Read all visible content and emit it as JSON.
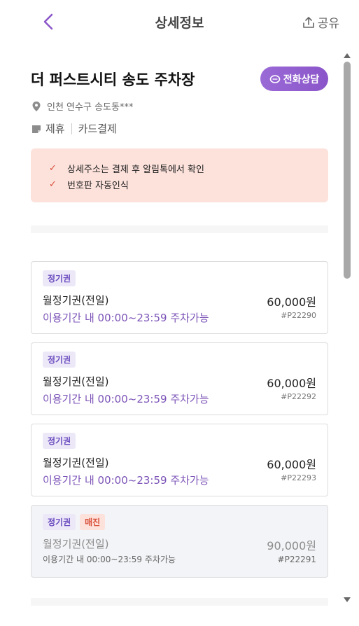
{
  "header": {
    "title": "상세정보",
    "share_label": "공유",
    "back_icon": "chevron-left-icon",
    "share_icon": "share-icon"
  },
  "lot": {
    "name": "더 퍼스트시티 송도 주차장",
    "call_label": "전화상담",
    "address": "인천 연수구 송도동***",
    "tags": [
      "제휴",
      "카드결제"
    ]
  },
  "notice": {
    "items": [
      "상세주소는 결제 후 알림톡에서 확인",
      "번호판 자동인식"
    ]
  },
  "tickets": [
    {
      "badge": "정기권",
      "name": "월정기권(전일)",
      "price": "60,000원",
      "desc": "이용기간 내 00:00~23:59 주차가능",
      "code": "#P22290"
    },
    {
      "badge": "정기권",
      "name": "월정기권(전일)",
      "price": "60,000원",
      "desc": "이용기간 내 00:00~23:59 주차가능",
      "code": "#P22292"
    },
    {
      "badge": "정기권",
      "name": "월정기권(전일)",
      "price": "60,000원",
      "desc": "이용기간 내 00:00~23:59 주차가능",
      "code": "#P22293"
    },
    {
      "badge": "정기권",
      "soldout_badge": "매진",
      "name": "월정기권(전일)",
      "price": "90,000원",
      "desc": "이용기간 내 00:00~23:59 주차가능",
      "code": "#P22291"
    }
  ],
  "colors": {
    "accent": "#8a55c9",
    "notice_bg": "#fde2dc",
    "check": "#d9503a"
  }
}
